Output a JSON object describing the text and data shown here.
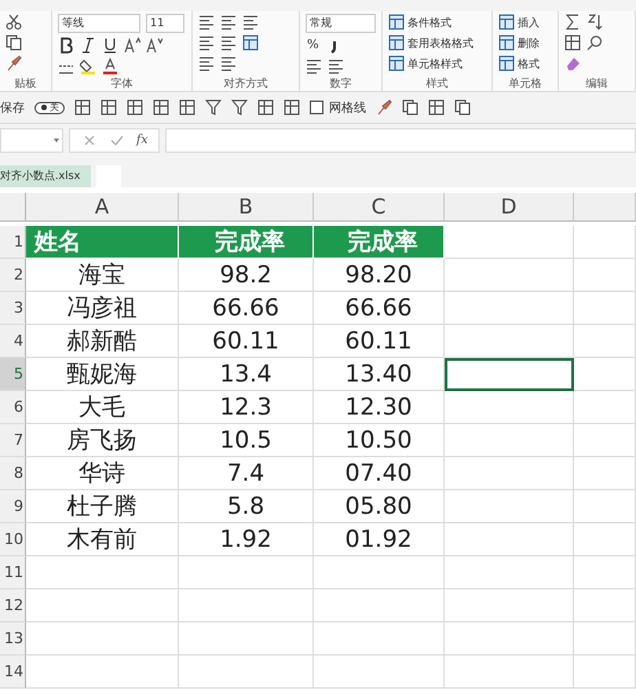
{
  "font": {
    "name": "等线",
    "size": "11"
  },
  "number_format": "常规",
  "number_symbol": "%",
  "style_commands": [
    "条件格式",
    "套用表格格式",
    "单元格样式"
  ],
  "cell_commands": [
    "插入",
    "删除",
    "格式"
  ],
  "group_labels": [
    "贴板",
    "字体",
    "对齐方式",
    "数字",
    "样式",
    "单元格",
    "编辑"
  ],
  "quick_bar": {
    "autosave_label": "保存",
    "autosave_state": "关",
    "autosave_on": false,
    "gridlines_label": "网格线",
    "gridlines_checked": false
  },
  "formula_bar": {
    "fx": "fx"
  },
  "file_tab": "对齐小数点.xlsx",
  "columns": [
    "A",
    "B",
    "C",
    "D"
  ],
  "rows": [
    {
      "number": "1",
      "kind": "header",
      "d_selected": false,
      "cells": [
        "姓名",
        "完成率",
        "完成率"
      ]
    },
    {
      "number": "2",
      "kind": "data",
      "d_selected": false,
      "cells": [
        "海宝",
        "98.2",
        "98.20"
      ]
    },
    {
      "number": "3",
      "kind": "data",
      "d_selected": false,
      "cells": [
        "冯彦祖",
        "66.66",
        "66.66"
      ]
    },
    {
      "number": "4",
      "kind": "data",
      "d_selected": false,
      "cells": [
        "郝新酷",
        "60.11",
        "60.11"
      ]
    },
    {
      "number": "5",
      "kind": "data",
      "d_selected": true,
      "cells": [
        "甄妮海",
        "13.4",
        "13.40"
      ]
    },
    {
      "number": "6",
      "kind": "data",
      "d_selected": false,
      "cells": [
        "大毛",
        "12.3",
        "12.30"
      ]
    },
    {
      "number": "7",
      "kind": "data",
      "d_selected": false,
      "cells": [
        "房飞扬",
        "10.5",
        "10.50"
      ]
    },
    {
      "number": "8",
      "kind": "data",
      "d_selected": false,
      "cells": [
        "华诗",
        "7.4",
        "07.40"
      ]
    },
    {
      "number": "9",
      "kind": "data",
      "d_selected": false,
      "cells": [
        "杜子腾",
        "5.8",
        "05.80"
      ]
    },
    {
      "number": "10",
      "kind": "data",
      "d_selected": false,
      "cells": [
        "木有前",
        "1.92",
        "01.92"
      ]
    },
    {
      "number": "11",
      "kind": "empty",
      "d_selected": false
    },
    {
      "number": "12",
      "kind": "empty",
      "d_selected": false
    },
    {
      "number": "13",
      "kind": "empty",
      "d_selected": false
    },
    {
      "number": "14",
      "kind": "empty",
      "d_selected": false
    }
  ]
}
